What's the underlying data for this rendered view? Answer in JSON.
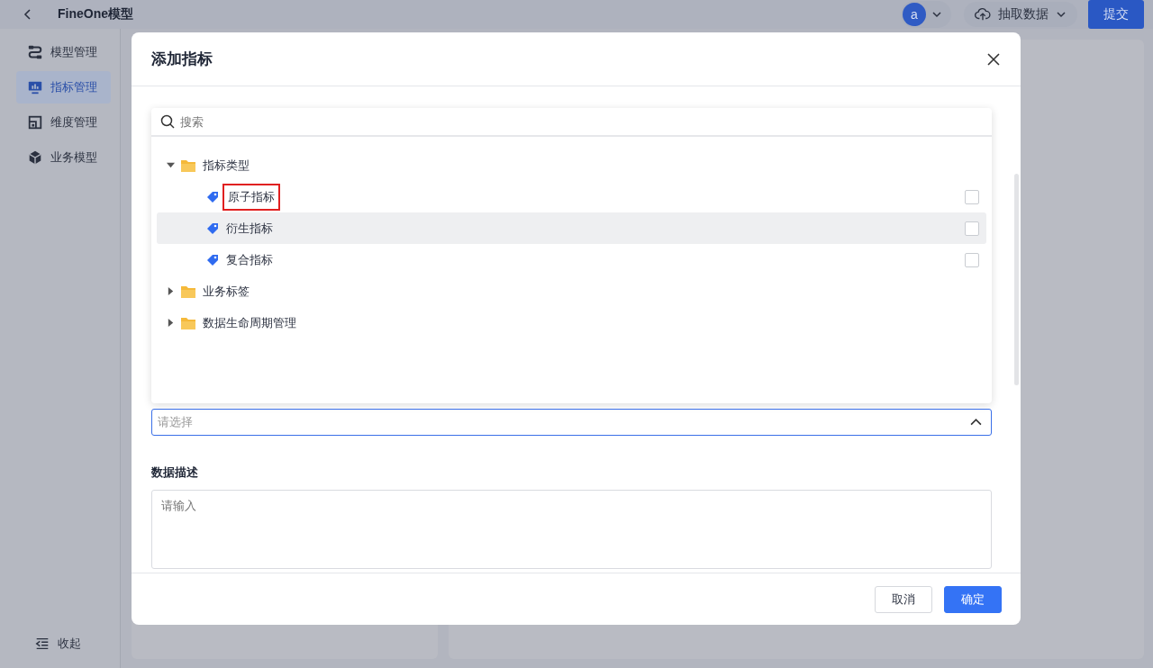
{
  "header": {
    "title": "FineOne模型",
    "avatar": "a",
    "extract_button": "抽取数据",
    "submit_button": "提交"
  },
  "sidebar": {
    "items": [
      {
        "label": "模型管理",
        "selected": false
      },
      {
        "label": "指标管理",
        "selected": true
      },
      {
        "label": "维度管理",
        "selected": false
      },
      {
        "label": "业务模型",
        "selected": false
      }
    ],
    "collapse": "收起"
  },
  "dialog": {
    "title": "添加指标",
    "search": {
      "placeholder": "搜索"
    },
    "tree": [
      {
        "label": "指标类型",
        "expanded": true,
        "children": [
          {
            "label": "原子指标",
            "checked": false,
            "highlighted": false,
            "annotated": true
          },
          {
            "label": "衍生指标",
            "checked": false,
            "highlighted": true,
            "annotated": false
          },
          {
            "label": "复合指标",
            "checked": false,
            "highlighted": false,
            "annotated": false
          }
        ]
      },
      {
        "label": "业务标签",
        "expanded": false
      },
      {
        "label": "数据生命周期管理",
        "expanded": false
      }
    ],
    "select": {
      "placeholder": "请选择",
      "open": true
    },
    "description": {
      "label": "数据描述",
      "placeholder": "请输入"
    },
    "buttons": [
      {
        "label": "取消",
        "kind": "secondary"
      },
      {
        "label": "确定",
        "kind": "primary"
      }
    ]
  }
}
